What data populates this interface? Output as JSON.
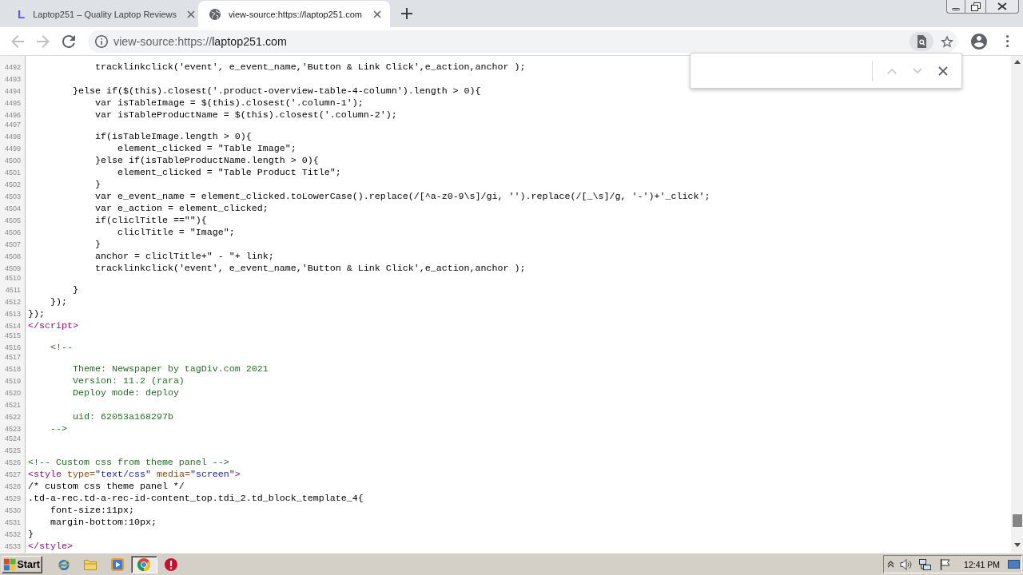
{
  "browser": {
    "tabs": [
      {
        "title": "Laptop251 – Quality Laptop Reviews",
        "logo_letter": "L",
        "selected": false
      },
      {
        "title": "view-source:https://laptop251.com",
        "selected": true
      }
    ],
    "navigation": {
      "back_disabled": true,
      "forward_disabled": true
    },
    "address_bar": {
      "prefix": "view-source:https://",
      "host": "laptop251.com"
    },
    "find_bar": {
      "previous_disabled": true,
      "next_disabled": true
    }
  },
  "source": {
    "lines": [
      {
        "number": "4492",
        "kind": "code",
        "tokens": [
          {
            "kind": "text",
            "text": "            tracklinkclick('event', e_event_name,'Button & Link Click',e_action,anchor );"
          }
        ]
      },
      {
        "number": "4493",
        "kind": "blank"
      },
      {
        "number": "4494",
        "kind": "code",
        "tokens": [
          {
            "kind": "text",
            "text": "        }else if($(this).closest('.product-overview-table-4-column').length > 0){"
          }
        ]
      },
      {
        "number": "4495",
        "kind": "code",
        "tokens": [
          {
            "kind": "text",
            "text": "            var isTableImage = $(this).closest('.column-1');"
          }
        ]
      },
      {
        "number": "4496",
        "kind": "code",
        "tokens": [
          {
            "kind": "text",
            "text": "            var isTableProductName = $(this).closest('.column-2');"
          }
        ]
      },
      {
        "number": "4497",
        "kind": "empty"
      },
      {
        "number": "4498",
        "kind": "code",
        "tokens": [
          {
            "kind": "text",
            "text": "            if(isTableImage.length > 0){"
          }
        ]
      },
      {
        "number": "4499",
        "kind": "code",
        "tokens": [
          {
            "kind": "text",
            "text": "                element_clicked = \"Table Image\";"
          }
        ]
      },
      {
        "number": "4500",
        "kind": "code",
        "tokens": [
          {
            "kind": "text",
            "text": "            }else if(isTableProductName.length > 0){"
          }
        ]
      },
      {
        "number": "4501",
        "kind": "code",
        "tokens": [
          {
            "kind": "text",
            "text": "                element_clicked = \"Table Product Title\";"
          }
        ]
      },
      {
        "number": "4502",
        "kind": "code",
        "tokens": [
          {
            "kind": "text",
            "text": "            }"
          }
        ]
      },
      {
        "number": "4503",
        "kind": "code",
        "tokens": [
          {
            "kind": "text",
            "text": "            var e_event_name = element_clicked.toLowerCase().replace(/[^a-z0-9\\s]/gi, '').replace(/[_\\s]/g, '-')+'_click';"
          }
        ]
      },
      {
        "number": "4504",
        "kind": "code",
        "tokens": [
          {
            "kind": "text",
            "text": "            var e_action = element_clicked;"
          }
        ]
      },
      {
        "number": "4505",
        "kind": "code",
        "tokens": [
          {
            "kind": "text",
            "text": "            if(cliclTitle ==\"\"){"
          }
        ]
      },
      {
        "number": "4506",
        "kind": "code",
        "tokens": [
          {
            "kind": "text",
            "text": "                cliclTitle = \"Image\";"
          }
        ]
      },
      {
        "number": "4507",
        "kind": "code",
        "tokens": [
          {
            "kind": "text",
            "text": "            }"
          }
        ]
      },
      {
        "number": "4508",
        "kind": "code",
        "tokens": [
          {
            "kind": "text",
            "text": "            anchor = cliclTitle+\" - \"+ link;"
          }
        ]
      },
      {
        "number": "4509",
        "kind": "code",
        "tokens": [
          {
            "kind": "text",
            "text": "            tracklinkclick('event', e_event_name,'Button & Link Click',e_action,anchor );"
          }
        ]
      },
      {
        "number": "4510",
        "kind": "empty"
      },
      {
        "number": "4511",
        "kind": "code",
        "tokens": [
          {
            "kind": "text",
            "text": "        }"
          }
        ]
      },
      {
        "number": "4512",
        "kind": "code",
        "tokens": [
          {
            "kind": "text",
            "text": "    });"
          }
        ]
      },
      {
        "number": "4513",
        "kind": "code",
        "tokens": [
          {
            "kind": "text",
            "text": "});"
          }
        ]
      },
      {
        "number": "4514",
        "kind": "code",
        "tokens": [
          {
            "kind": "tag",
            "text": "</script>"
          }
        ]
      },
      {
        "number": "4515",
        "kind": "empty"
      },
      {
        "number": "4516",
        "kind": "code",
        "tokens": [
          {
            "kind": "comment",
            "text": "    <!--"
          }
        ]
      },
      {
        "number": "4517",
        "kind": "empty"
      },
      {
        "number": "4518",
        "kind": "code",
        "tokens": [
          {
            "kind": "comment",
            "text": "        Theme: Newspaper by tagDiv.com 2021"
          }
        ]
      },
      {
        "number": "4519",
        "kind": "code",
        "tokens": [
          {
            "kind": "comment",
            "text": "        Version: 11.2 (rara)"
          }
        ]
      },
      {
        "number": "4520",
        "kind": "code",
        "tokens": [
          {
            "kind": "comment",
            "text": "        Deploy mode: deploy"
          }
        ]
      },
      {
        "number": "4521",
        "kind": "blank"
      },
      {
        "number": "4522",
        "kind": "code",
        "tokens": [
          {
            "kind": "comment",
            "text": "        uid: 62053a168297b"
          }
        ]
      },
      {
        "number": "4523",
        "kind": "code",
        "tokens": [
          {
            "kind": "comment",
            "text": "    -->"
          }
        ]
      },
      {
        "number": "4524",
        "kind": "empty"
      },
      {
        "number": "4525",
        "kind": "blank"
      },
      {
        "number": "4526",
        "kind": "code",
        "tokens": [
          {
            "kind": "comment",
            "text": "<!-- Custom css from theme panel -->"
          }
        ]
      },
      {
        "number": "4527",
        "kind": "code",
        "tokens": [
          {
            "kind": "tag",
            "text": "<style"
          },
          {
            "kind": "attr",
            "text": " type="
          },
          {
            "kind": "value",
            "text": "\"text/css\""
          },
          {
            "kind": "attr",
            "text": " media="
          },
          {
            "kind": "value",
            "text": "\"screen\""
          },
          {
            "kind": "tag",
            "text": ">"
          }
        ]
      },
      {
        "number": "4528",
        "kind": "code",
        "tokens": [
          {
            "kind": "text",
            "text": "/* custom css theme panel */"
          }
        ]
      },
      {
        "number": "4529",
        "kind": "code",
        "tokens": [
          {
            "kind": "text",
            "text": ".td-a-rec.td-a-rec-id-content_top.tdi_2.td_block_template_4{"
          }
        ]
      },
      {
        "number": "4530",
        "kind": "code",
        "tokens": [
          {
            "kind": "text",
            "text": "    font-size:11px;"
          }
        ]
      },
      {
        "number": "4531",
        "kind": "code",
        "tokens": [
          {
            "kind": "text",
            "text": "    margin-bottom:10px;"
          }
        ]
      },
      {
        "number": "4532",
        "kind": "code",
        "tokens": [
          {
            "kind": "text",
            "text": "}"
          }
        ]
      },
      {
        "number": "4533",
        "kind": "code",
        "tokens": [
          {
            "kind": "tag",
            "text": "</style>"
          }
        ]
      }
    ]
  },
  "taskbar": {
    "start": "Start",
    "apps": [
      {
        "kind": "ie",
        "selected": false
      },
      {
        "kind": "explorer",
        "selected": false
      },
      {
        "kind": "player",
        "selected": false
      },
      {
        "kind": "chrome",
        "selected": true
      },
      {
        "kind": "alert",
        "selected": false
      }
    ],
    "clock": "12:41 PM"
  }
}
